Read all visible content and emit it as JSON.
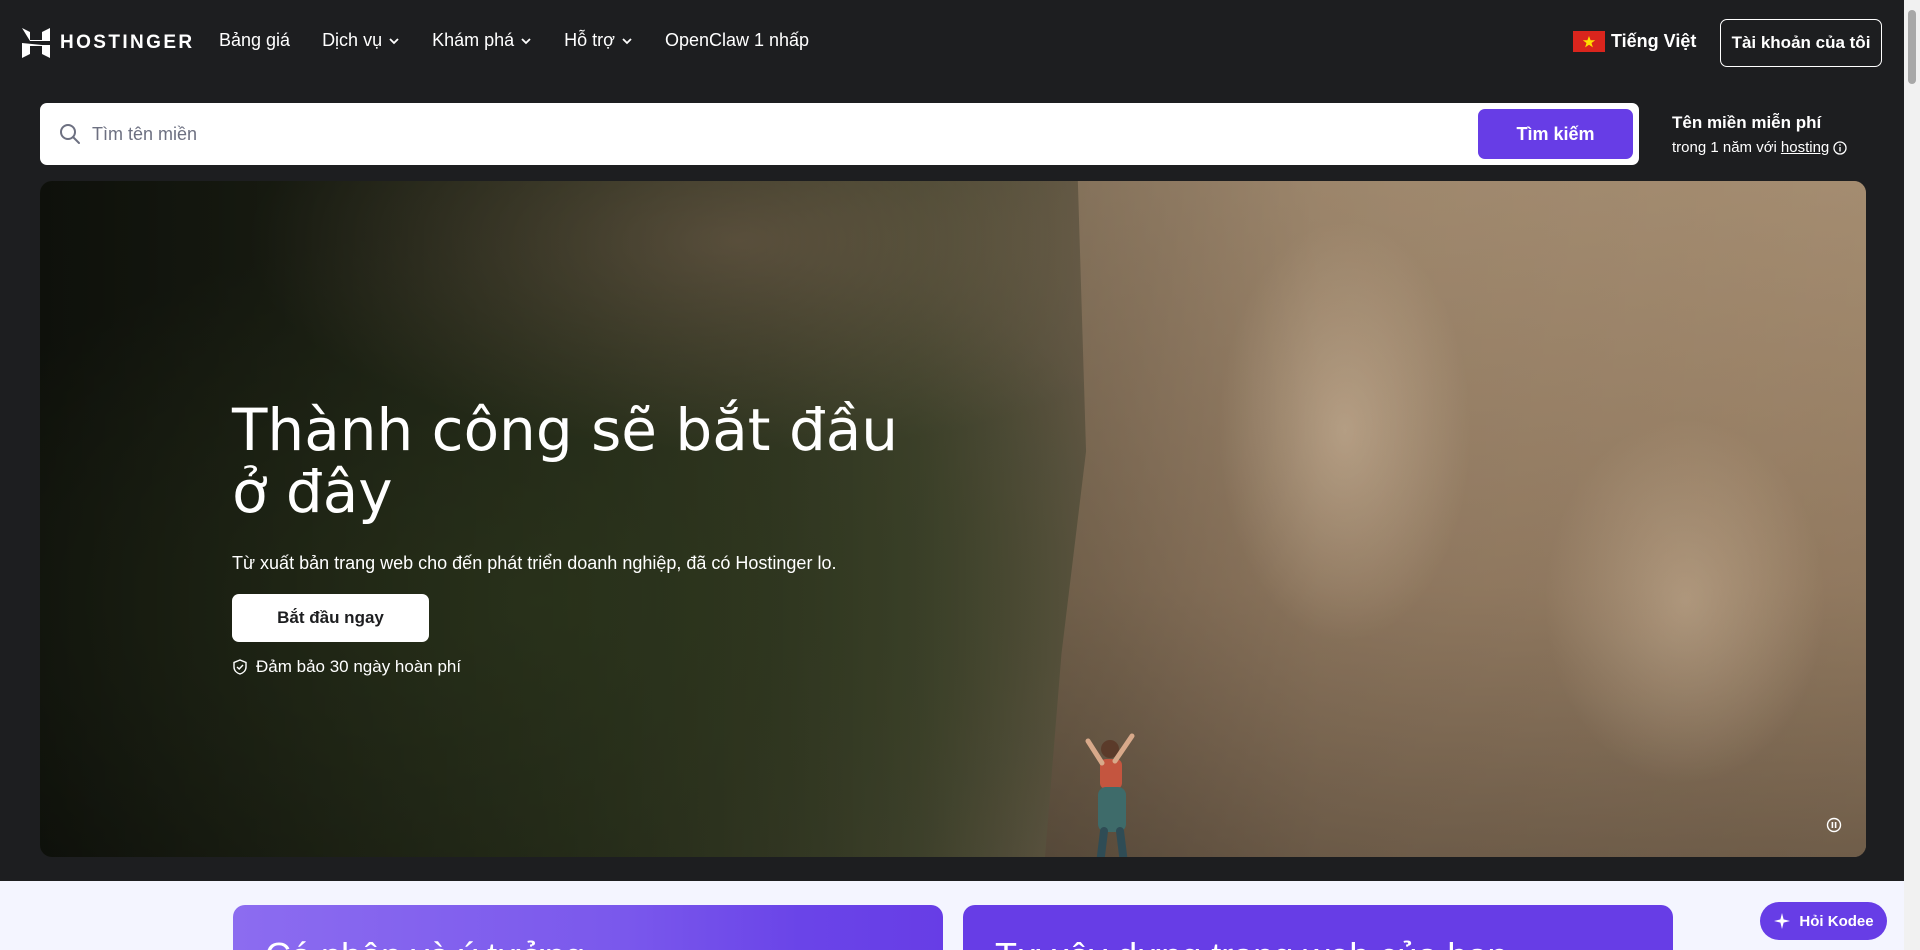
{
  "nav": {
    "logo_text": "HOSTINGER",
    "links": [
      {
        "label": "Bảng giá",
        "has_dropdown": false
      },
      {
        "label": "Dịch vụ",
        "has_dropdown": true
      },
      {
        "label": "Khám phá",
        "has_dropdown": true
      },
      {
        "label": "Hỗ trợ",
        "has_dropdown": true
      },
      {
        "label": "OpenClaw 1 nhấp",
        "has_dropdown": false
      }
    ],
    "language": "Tiếng Việt",
    "account_button": "Tài khoản của tôi"
  },
  "search": {
    "placeholder": "Tìm tên miền",
    "button": "Tìm kiếm",
    "promo_title": "Tên miền miễn phí",
    "promo_sub_prefix": "trong 1 năm với",
    "promo_link": "hosting"
  },
  "hero": {
    "title": "Thành công sẽ bắt đầu ở đây",
    "subtitle": "Từ xuất bản trang web cho đến phát triển doanh nghiệp, đã có Hostinger lo.",
    "cta": "Bắt đầu ngay",
    "guarantee": "Đảm bảo 30 ngày hoàn phí"
  },
  "cards": [
    {
      "title": "Cá nhân và ý tưởng"
    },
    {
      "title": "Tự xây dựng trang web của bạn"
    }
  ],
  "assistant": {
    "label": "Hỏi Kodee"
  },
  "icons": {
    "search": "search-icon",
    "info": "info-icon",
    "shield": "shield-check-icon",
    "pause": "pause-icon",
    "chevron": "chevron-down-icon",
    "kodee": "sparkle-icon",
    "flag": "vietnam-flag-icon"
  },
  "colors": {
    "brand_purple": "#673de6",
    "nav_bg": "#1d1e20",
    "light_bg": "#f4f5ff"
  }
}
